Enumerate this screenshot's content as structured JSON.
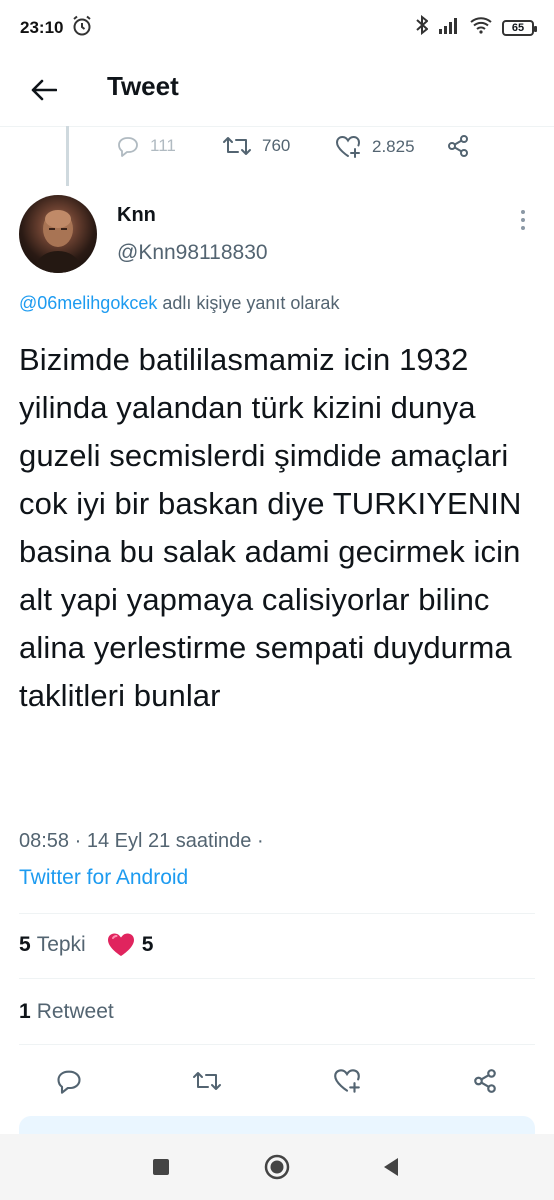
{
  "status_bar": {
    "time": "23:10",
    "battery": "65",
    "icons": [
      "alarm-icon",
      "bluetooth-icon",
      "signal-icon",
      "wifi-icon",
      "battery-icon"
    ]
  },
  "header": {
    "title": "Tweet",
    "back_icon": "arrow-left-icon"
  },
  "previous_tweet_actions": {
    "replies": "111",
    "retweets": "760",
    "likes": "2.825"
  },
  "tweet": {
    "author_name": "Knn",
    "author_handle": "@Knn98118830",
    "reply_mention": "@06melihgokcek",
    "reply_suffix": "adlı kişiye yanıt olarak",
    "text": "Bizimde batililasmamiz icin 1932 yilinda yalandan türk kizini dunya guzeli secmislerdi şimdide amaçlari cok iyi bir baskan diye TURKIYENIN basina bu salak adami gecirmek icin alt yapi yapmaya calisiyorlar bilinc alina yerlestirme sempati duydurma taklitleri bunlar",
    "time": "08:58",
    "date_text": "14 Eyl 21 saatinde",
    "separator": "·",
    "source": "Twitter for Android"
  },
  "stats": {
    "reactions_count": "5",
    "reactions_label": "Tepki",
    "heart_count": "5",
    "retweets_count": "1",
    "retweets_label": "Retweet"
  },
  "colors": {
    "accent": "#1d9bf0",
    "secondary_text": "#536471",
    "heart": "#e0245e"
  }
}
